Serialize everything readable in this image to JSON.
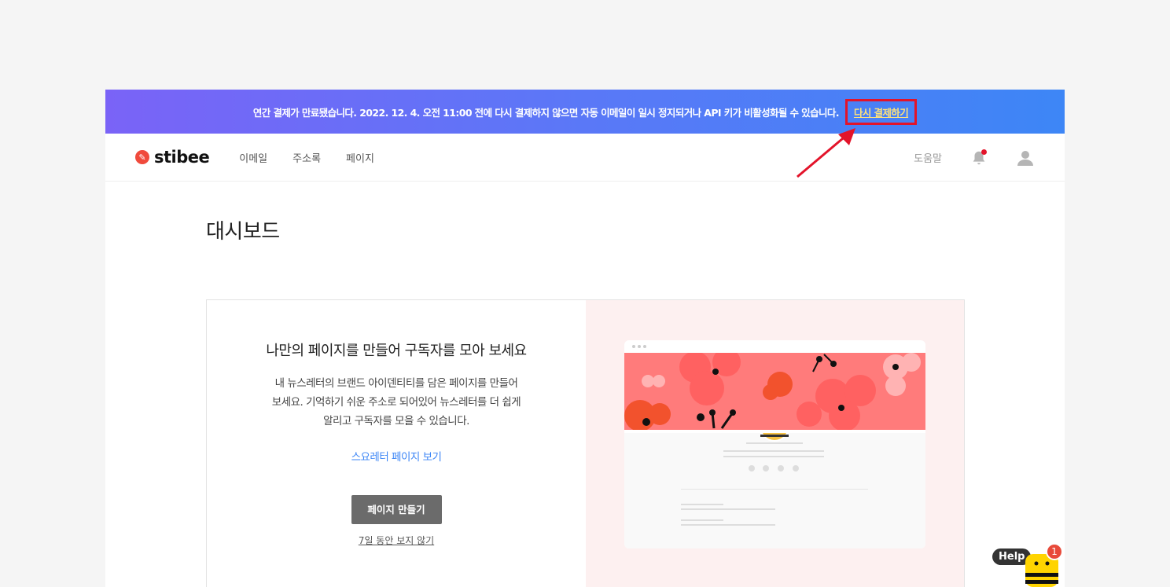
{
  "banner": {
    "message": "연간 결제가 만료됐습니다. 2022. 12. 4. 오전 11:00 전에 다시 결제하지 않으면 자동 이메일이 일시 정지되거나 API 키가 비활성화될 수 있습니다.",
    "retry_label": "다시 결제하기"
  },
  "nav": {
    "logo_text": "stibee",
    "items": [
      {
        "label": "이메일"
      },
      {
        "label": "주소록"
      },
      {
        "label": "페이지"
      }
    ],
    "help_label": "도움말"
  },
  "page": {
    "title": "대시보드"
  },
  "card": {
    "title": "나만의 페이지를 만들어 구독자를 모아 보세요",
    "desc_lines": [
      "내 뉴스레터의 브랜드 아이덴티티를 담은 페이지를 만들어",
      "보세요. 기억하기 쉬운 주소로 되어있어 뉴스레터를 더 쉽게",
      "알리고 구독자를 모을 수 있습니다."
    ],
    "link_label": "스요레터 페이지 보기",
    "button_label": "페이지 만들기",
    "dismiss_label": "7일 동안 보지 않기"
  },
  "help_widget": {
    "label": "Help",
    "badge_count": "1"
  },
  "colors": {
    "banner_start": "#7a63f7",
    "banner_end": "#3d86f6",
    "accent_link": "#3d86f6",
    "alert_red": "#e3132a",
    "preview_hero": "#ff7b7b"
  }
}
